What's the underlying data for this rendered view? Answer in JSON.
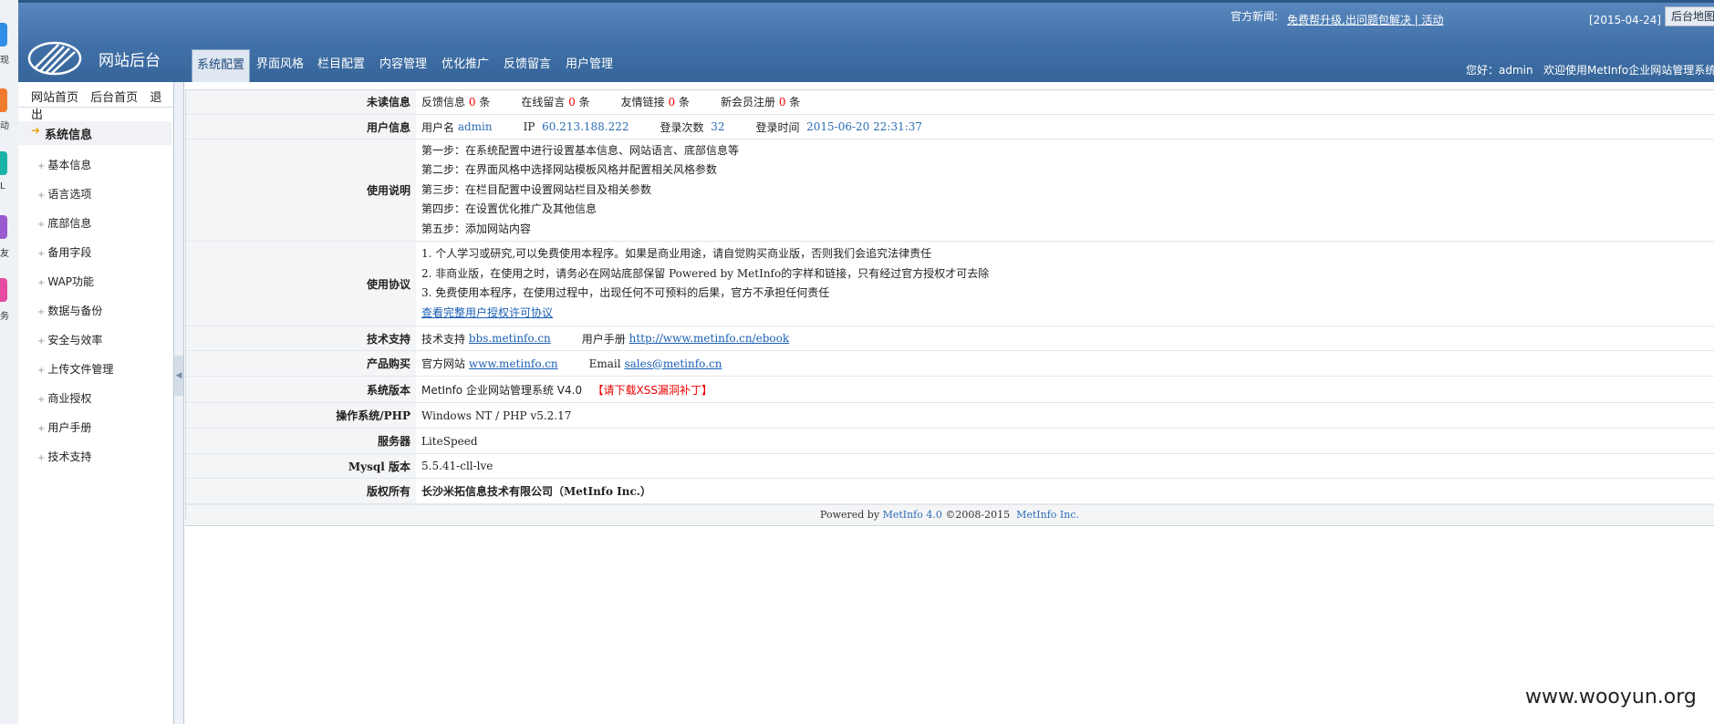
{
  "strip": {
    "chars": [
      "现",
      "动",
      "L",
      "友",
      "务"
    ],
    "colors": [
      "#2f8fe6",
      "#f07b2c",
      "#19b3a8",
      "#9b59d0",
      "#e64ba3"
    ]
  },
  "header": {
    "site_title": "网站后台",
    "news_label": "官方新闻:",
    "news_link": "免费帮升级,出问题包解决 | 活动",
    "date": "[2015-04-24]",
    "sitemap_button": "后台地图",
    "welcome": "您好：admin   欢迎使用MetInfo企业网站管理系统!"
  },
  "nav": {
    "tabs": [
      {
        "label": "系统配置",
        "active": true
      },
      {
        "label": "界面风格",
        "active": false
      },
      {
        "label": "栏目配置",
        "active": false
      },
      {
        "label": "内容管理",
        "active": false
      },
      {
        "label": "优化推广",
        "active": false
      },
      {
        "label": "反馈留言",
        "active": false
      },
      {
        "label": "用户管理",
        "active": false
      }
    ]
  },
  "sidebar": {
    "top_links": [
      "网站首页",
      "后台首页",
      "退出"
    ],
    "section": "系统信息",
    "items": [
      "基本信息",
      "语言选项",
      "底部信息",
      "备用字段",
      "WAP功能",
      "数据与备份",
      "安全与效率",
      "上传文件管理",
      "商业授权",
      "用户手册",
      "技术支持"
    ]
  },
  "info": {
    "unread": {
      "label": "未读信息",
      "feedback_label": "反馈信息",
      "feedback_count": "0",
      "feedback_unit": "条",
      "message_label": "在线留言",
      "message_count": "0",
      "message_unit": "条",
      "links_label": "友情链接",
      "links_count": "0",
      "links_unit": "条",
      "members_label": "新会员注册",
      "members_count": "0",
      "members_unit": "条"
    },
    "user": {
      "label": "用户信息",
      "name_label": "用户名",
      "name": "admin",
      "ip_label": "IP",
      "ip": "60.213.188.222",
      "logins_label": "登录次数",
      "logins": "32",
      "time_label": "登录时间",
      "time": "2015-06-20 22:31:37"
    },
    "usage": {
      "label": "使用说明",
      "steps": [
        "第一步：在系统配置中进行设置基本信息、网站语言、底部信息等",
        "第二步：在界面风格中选择网站模板风格并配置相关风格参数",
        "第三步：在栏目配置中设置网站栏目及相关参数",
        "第四步：在设置优化推广及其他信息",
        "第五步：添加网站内容"
      ]
    },
    "agreement": {
      "label": "使用协议",
      "lines": [
        "1. 个人学习或研究,可以免费使用本程序。如果是商业用途，请自觉购买商业版，否则我们会追究法律责任",
        "2. 非商业版，在使用之时，请务必在网站底部保留 Powered by MetInfo的字样和链接，只有经过官方授权才可去除",
        "3. 免费使用本程序，在使用过程中，出现任何不可预料的后果，官方不承担任何责任"
      ],
      "link": "查看完整用户授权许可协议"
    },
    "support": {
      "label": "技术支持",
      "tech_label": "技术支持",
      "tech_link": "bbs.metinfo.cn",
      "manual_label": "用户手册",
      "manual_link": "http://www.metinfo.cn/ebook"
    },
    "purchase": {
      "label": "产品购买",
      "site_label": "官方网站",
      "site_link": "www.metinfo.cn",
      "email_label": "Email",
      "email_link": "sales@metinfo.cn"
    },
    "version": {
      "label": "系统版本",
      "value": "MetInfo 企业网站管理系统 V4.0",
      "patch": "【请下载XSS漏洞补丁】"
    },
    "os": {
      "label": "操作系统/PHP",
      "value": "Windows NT / PHP v5.2.17"
    },
    "server": {
      "label": "服务器",
      "value": "LiteSpeed"
    },
    "mysql": {
      "label": "Mysql 版本",
      "value": "5.5.41-cll-lve"
    },
    "copyright": {
      "label": "版权所有",
      "value": "长沙米拓信息技术有限公司（MetInfo Inc.）"
    }
  },
  "footer": {
    "powered": "Powered by",
    "product": "MetInfo 4.0",
    "years": "©2008-2015",
    "company": "MetInfo Inc."
  },
  "watermark": "www.wooyun.org"
}
